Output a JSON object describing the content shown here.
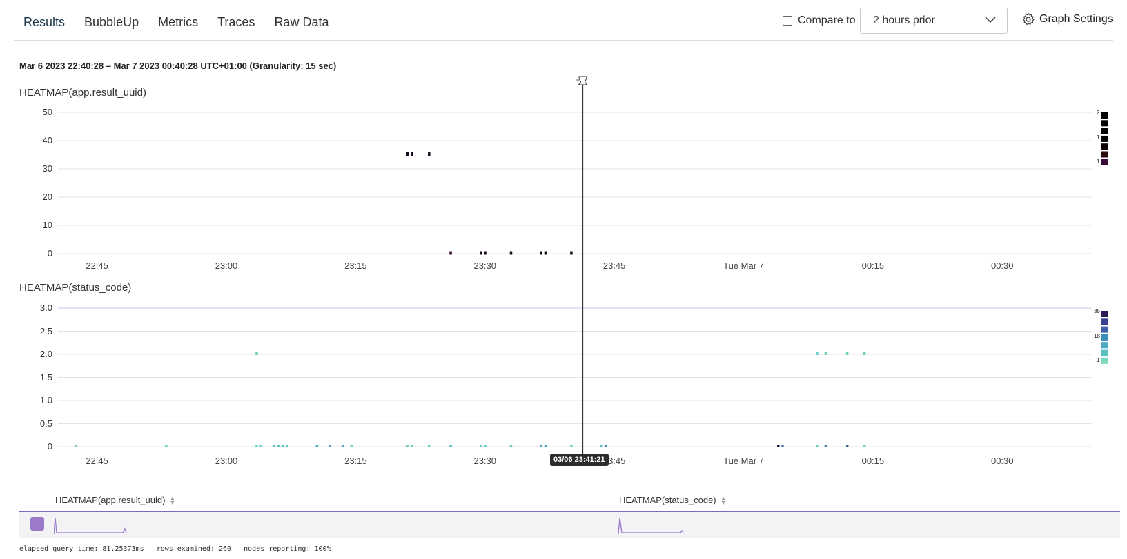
{
  "tabs": [
    "Results",
    "BubbleUp",
    "Metrics",
    "Traces",
    "Raw Data"
  ],
  "compare": {
    "label": "Compare to",
    "selected": "2 hours prior"
  },
  "graph_settings_label": "Graph Settings",
  "time_range": "Mar 6 2023 22:40:28 – Mar 7 2023 00:40:28 UTC+01:00 (Granularity: 15 sec)",
  "cursor_tooltip": "03/06 23:41:21",
  "summary": {
    "col1": "HEATMAP(app.result_uuid)",
    "col2": "HEATMAP(status_code)"
  },
  "footer": {
    "elapsed": "elapsed query time: 81.25373ms",
    "rows": "rows examined: 260",
    "nodes": "nodes reporting: 100%"
  },
  "colors": {
    "accent": "#2d7fc1",
    "purple": "#9b7bc9"
  },
  "chart_data": [
    {
      "type": "heatmap",
      "title": "HEATMAP(app.result_uuid)",
      "x_ticks": [
        "22:45",
        "23:00",
        "23:15",
        "23:30",
        "23:45",
        "Tue Mar 7",
        "00:15",
        "00:30"
      ],
      "y_ticks": [
        "50",
        "40",
        "30",
        "20",
        "10",
        "0"
      ],
      "ylim": [
        0,
        50
      ],
      "legend_labels": [
        "2",
        "1",
        "1"
      ],
      "points": [
        {
          "t": "23:21:00",
          "y": 35,
          "c": "#1a0a20"
        },
        {
          "t": "23:21:30",
          "y": 35,
          "c": "#1a0a20"
        },
        {
          "t": "23:23:30",
          "y": 35,
          "c": "#1a0a20"
        },
        {
          "t": "23:26:00",
          "y": 0,
          "c": "#3a0a30"
        },
        {
          "t": "23:29:30",
          "y": 0,
          "c": "#1a0a20"
        },
        {
          "t": "23:30:00",
          "y": 0,
          "c": "#1a0a20"
        },
        {
          "t": "23:33:00",
          "y": 0,
          "c": "#1a0a20"
        },
        {
          "t": "23:36:30",
          "y": 0,
          "c": "#1a0a20"
        },
        {
          "t": "23:37:00",
          "y": 0,
          "c": "#1a0a20"
        },
        {
          "t": "23:40:00",
          "y": 0,
          "c": "#1a0a20"
        }
      ]
    },
    {
      "type": "heatmap",
      "title": "HEATMAP(status_code)",
      "x_ticks": [
        "22:45",
        "23:00",
        "23:15",
        "23:30",
        "23:45",
        "Tue Mar 7",
        "00:15",
        "00:30"
      ],
      "y_ticks": [
        "3.0",
        "2.5",
        "2.0",
        "1.5",
        "1.0",
        "0.5",
        "0"
      ],
      "ylim": [
        0,
        3
      ],
      "legend_labels": [
        "35",
        "18",
        "1"
      ],
      "points": [
        {
          "t": "23:03:30",
          "y": 2,
          "c": "#6ccfbf"
        },
        {
          "t": "00:08:30",
          "y": 2,
          "c": "#6ccfbf"
        },
        {
          "t": "00:09:30",
          "y": 2,
          "c": "#6ccfbf"
        },
        {
          "t": "00:12:00",
          "y": 2,
          "c": "#6ccfbf"
        },
        {
          "t": "00:14:00",
          "y": 2,
          "c": "#6ccfbf"
        },
        {
          "t": "22:42:30",
          "y": 0,
          "c": "#6ccfbf"
        },
        {
          "t": "22:53:00",
          "y": 0,
          "c": "#6ccfbf"
        },
        {
          "t": "23:03:30",
          "y": 0,
          "c": "#6ccfbf"
        },
        {
          "t": "23:04:00",
          "y": 0,
          "c": "#6ccfbf"
        },
        {
          "t": "23:05:30",
          "y": 0,
          "c": "#5bc0c0"
        },
        {
          "t": "23:06:00",
          "y": 0,
          "c": "#5bc0c0"
        },
        {
          "t": "23:06:30",
          "y": 0,
          "c": "#5bc0c0"
        },
        {
          "t": "23:07:00",
          "y": 0,
          "c": "#5bc0c0"
        },
        {
          "t": "23:10:30",
          "y": 0,
          "c": "#4aa8c0"
        },
        {
          "t": "23:12:00",
          "y": 0,
          "c": "#4aa8c0"
        },
        {
          "t": "23:13:30",
          "y": 0,
          "c": "#4aa8c0"
        },
        {
          "t": "23:14:30",
          "y": 0,
          "c": "#6ccfbf"
        },
        {
          "t": "23:21:00",
          "y": 0,
          "c": "#6ccfbf"
        },
        {
          "t": "23:21:30",
          "y": 0,
          "c": "#6ccfbf"
        },
        {
          "t": "23:23:30",
          "y": 0,
          "c": "#6ccfbf"
        },
        {
          "t": "23:26:00",
          "y": 0,
          "c": "#5bc0c0"
        },
        {
          "t": "23:29:30",
          "y": 0,
          "c": "#6ccfbf"
        },
        {
          "t": "23:30:00",
          "y": 0,
          "c": "#6ccfbf"
        },
        {
          "t": "23:33:00",
          "y": 0,
          "c": "#6ccfbf"
        },
        {
          "t": "23:36:30",
          "y": 0,
          "c": "#4aa8c0"
        },
        {
          "t": "23:37:00",
          "y": 0,
          "c": "#4aa8c0"
        },
        {
          "t": "23:40:00",
          "y": 0,
          "c": "#6ccfbf"
        },
        {
          "t": "23:43:30",
          "y": 0,
          "c": "#5bc0c0"
        },
        {
          "t": "23:44:00",
          "y": 0,
          "c": "#3f7fb0"
        },
        {
          "t": "00:04:00",
          "y": 0,
          "c": "#1c1a4a"
        },
        {
          "t": "00:04:30",
          "y": 0,
          "c": "#3f7fb0"
        },
        {
          "t": "00:08:30",
          "y": 0,
          "c": "#6ccfbf"
        },
        {
          "t": "00:09:30",
          "y": 0,
          "c": "#3f7fb0"
        },
        {
          "t": "00:12:00",
          "y": 0,
          "c": "#3f5fa0"
        },
        {
          "t": "00:14:00",
          "y": 0,
          "c": "#6ccfbf"
        }
      ]
    }
  ]
}
